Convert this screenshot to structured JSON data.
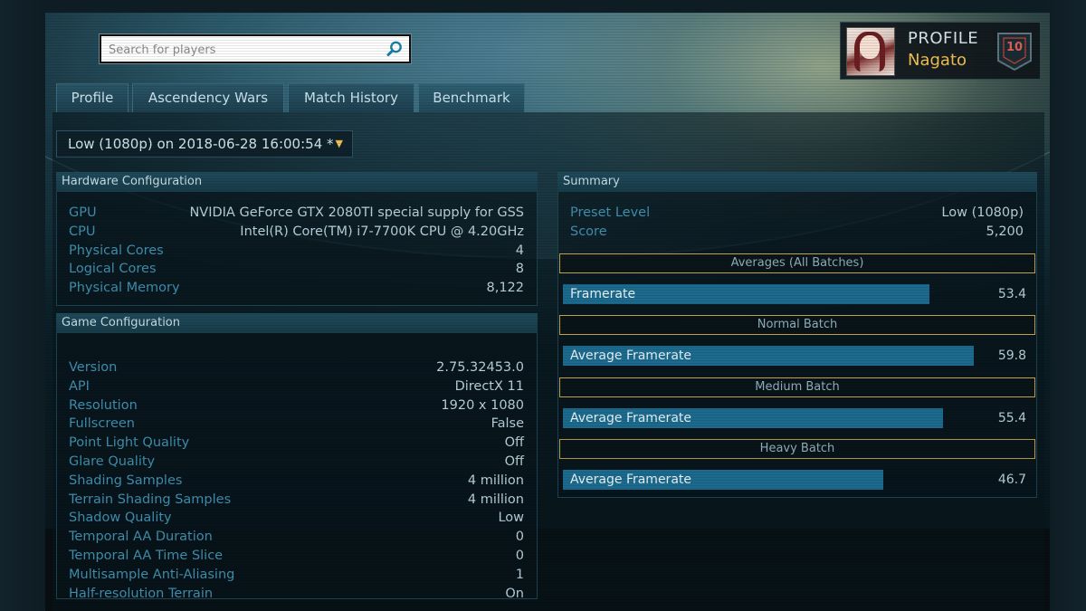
{
  "search": {
    "placeholder": "Search for players"
  },
  "tabs": [
    {
      "label": "Profile"
    },
    {
      "label": "Ascendency Wars"
    },
    {
      "label": "Match History"
    },
    {
      "label": "Benchmark"
    }
  ],
  "profile": {
    "label": "PROFILE",
    "name": "Nagato",
    "level": "10"
  },
  "run_selector": {
    "value": "Low (1080p) on 2018-06-28 16:00:54 *"
  },
  "hardware": {
    "title": "Hardware Configuration",
    "rows": [
      {
        "key": "GPU",
        "value": "NVIDIA GeForce GTX 2080TI special supply for GSS"
      },
      {
        "key": "CPU",
        "value": "Intel(R) Core(TM) i7-7700K CPU @ 4.20GHz"
      },
      {
        "key": "Physical Cores",
        "value": "4"
      },
      {
        "key": "Logical Cores",
        "value": "8"
      },
      {
        "key": "Physical Memory",
        "value": "8,122"
      }
    ]
  },
  "game": {
    "title": "Game Configuration",
    "rows": [
      {
        "key": "Version",
        "value": "2.75.32453.0"
      },
      {
        "key": "API",
        "value": "DirectX 11"
      },
      {
        "key": "Resolution",
        "value": "1920 x 1080"
      },
      {
        "key": "Fullscreen",
        "value": "False"
      },
      {
        "key": "Point Light Quality",
        "value": "Off"
      },
      {
        "key": "Glare Quality",
        "value": "Off"
      },
      {
        "key": "Shading Samples",
        "value": "4 million"
      },
      {
        "key": "Terrain Shading Samples",
        "value": "4 million"
      },
      {
        "key": "Shadow Quality",
        "value": "Low"
      },
      {
        "key": "Temporal AA Duration",
        "value": "0"
      },
      {
        "key": "Temporal AA Time Slice",
        "value": "0"
      },
      {
        "key": "Multisample Anti-Aliasing",
        "value": "1"
      },
      {
        "key": "Half-resolution Terrain",
        "value": "On"
      }
    ]
  },
  "summary": {
    "title": "Summary",
    "rows": [
      {
        "key": "Preset Level",
        "value": "Low (1080p)"
      },
      {
        "key": "Score",
        "value": "5,200"
      }
    ],
    "bar_max": 70,
    "batches": [
      {
        "header": "Averages (All Batches)",
        "label": "Framerate",
        "value": 53.4,
        "value_text": "53.4"
      },
      {
        "header": "Normal Batch",
        "label": "Average Framerate",
        "value": 59.8,
        "value_text": "59.8"
      },
      {
        "header": "Medium Batch",
        "label": "Average Framerate",
        "value": 55.4,
        "value_text": "55.4"
      },
      {
        "header": "Heavy Batch",
        "label": "Average Framerate",
        "value": 46.7,
        "value_text": "46.7"
      }
    ]
  },
  "colors": {
    "accent_gold": "#f0c052",
    "bar_fill": "#1c6b8e",
    "key_text": "#3f8fae"
  }
}
